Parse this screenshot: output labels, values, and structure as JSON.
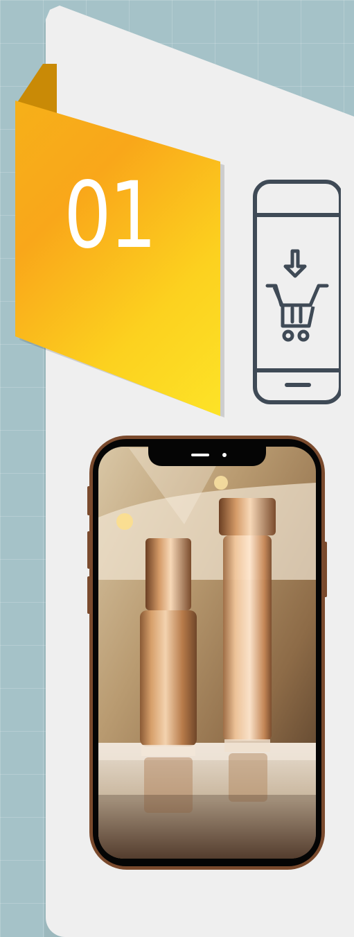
{
  "step": {
    "number": "01"
  },
  "icons": {
    "main_icon": "mobile-shopping-cart-download-icon"
  },
  "colors": {
    "background": "#a5c2c8",
    "card": "#efefef",
    "badge_start": "#f6b019",
    "badge_end": "#fde327",
    "icon_stroke": "#3f4a56",
    "phone_frame": "#050505",
    "phone_bezel": "#7a4a2d"
  },
  "image": {
    "subject": "gold-cosmetic-bottles-on-mirror"
  }
}
